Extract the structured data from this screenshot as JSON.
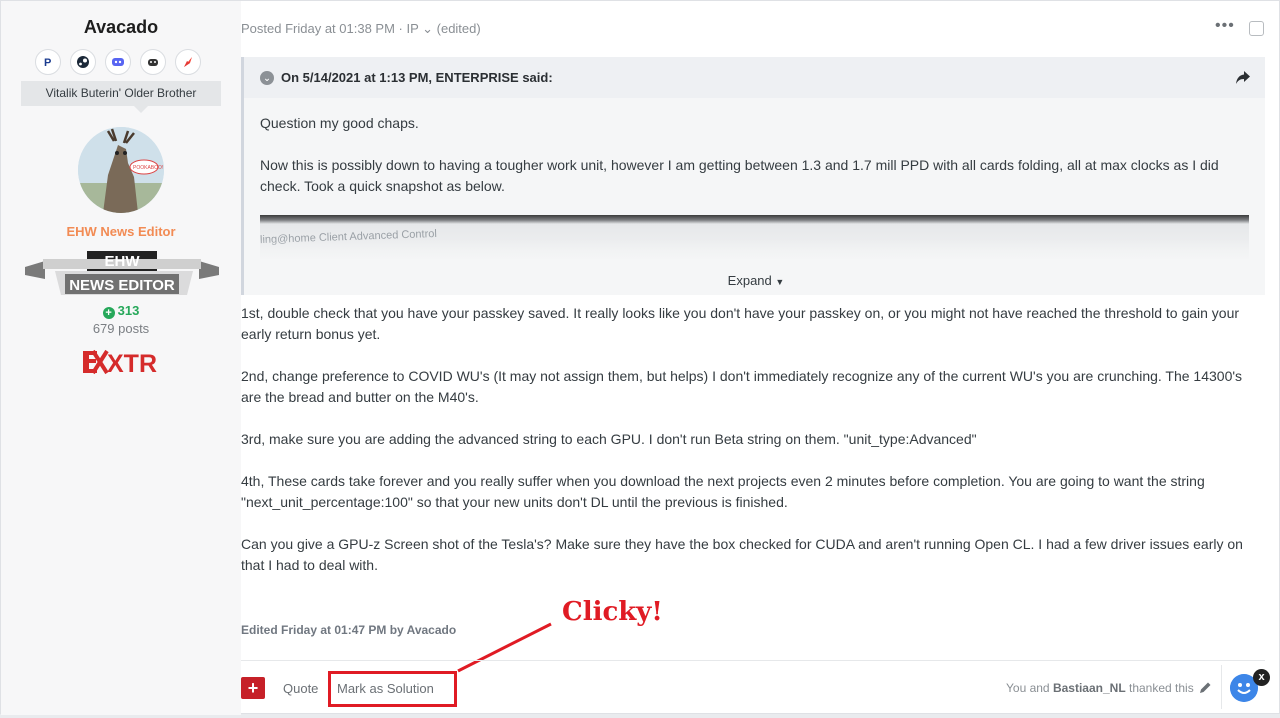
{
  "author": {
    "username": "Avacado",
    "social_icons": [
      "paypal-icon",
      "steam-icon",
      "discord-icon",
      "xbox-icon",
      "origin-icon"
    ],
    "tooltip": "Vitalik Buterin' Older Brother",
    "avatar_caption": "POOKABOO!",
    "rank_title": "EHW News Editor",
    "badge_line1": "EHW",
    "badge_line2": "NEWS EDITOR",
    "reputation": "313",
    "post_count": "679 posts",
    "logo_text": "XTR"
  },
  "post": {
    "meta": "Posted Friday at 01:38 PM · IP ⌄ (edited)",
    "more_label": "•••",
    "quote": {
      "header": "On 5/14/2021 at 1:13 PM, ENTERPRISE said:",
      "paragraphs": [
        "Question my good chaps.",
        "Now this is possibly down to having a tougher work unit, however I am getting between 1.3 and 1.7 mill PPD with all cards folding, all at max clocks as I did check. Took a quick snapshot as below."
      ],
      "snapshot_caption": "ling@home Client Advanced Control",
      "expand_label": "Expand"
    },
    "paragraphs": [
      "1st, double check that you have your passkey saved. It really looks like you don't have your passkey on, or you might not have reached the threshold to gain your early return bonus yet.",
      "2nd, change preference to COVID WU's (It may not assign them, but helps) I don't immediately recognize any of the current WU's you are crunching. The 14300's are the bread and butter on the M40's.",
      "3rd, make sure you are adding the advanced string to each GPU. I don't run Beta string on them. \"unit_type:Advanced\"",
      "4th, These cards take forever and you really suffer when you download the next projects even 2 minutes before completion. You are going to want the string \"next_unit_percentage:100\" so that your new units don't DL until the previous is finished.",
      "Can you give a GPU-z Screen shot of the Tesla's? Make sure they have the box checked for CUDA and aren't running Open CL. I had a few driver issues early on that I had to deal with."
    ],
    "edited": "Edited Friday at 01:47 PM by Avacado"
  },
  "annotation": {
    "text": "Clicky!",
    "color": "#e01b24"
  },
  "actions": {
    "add_label": "+",
    "quote_label": "Quote",
    "mark_solution_label": "Mark as Solution"
  },
  "reactions": {
    "prefix": "You and ",
    "user": "Bastiaan_NL",
    "suffix": " thanked this",
    "close_label": "x"
  },
  "colors": {
    "brand_red": "#c62028",
    "rank_orange": "#f28b54",
    "rep_green": "#26a85a"
  }
}
